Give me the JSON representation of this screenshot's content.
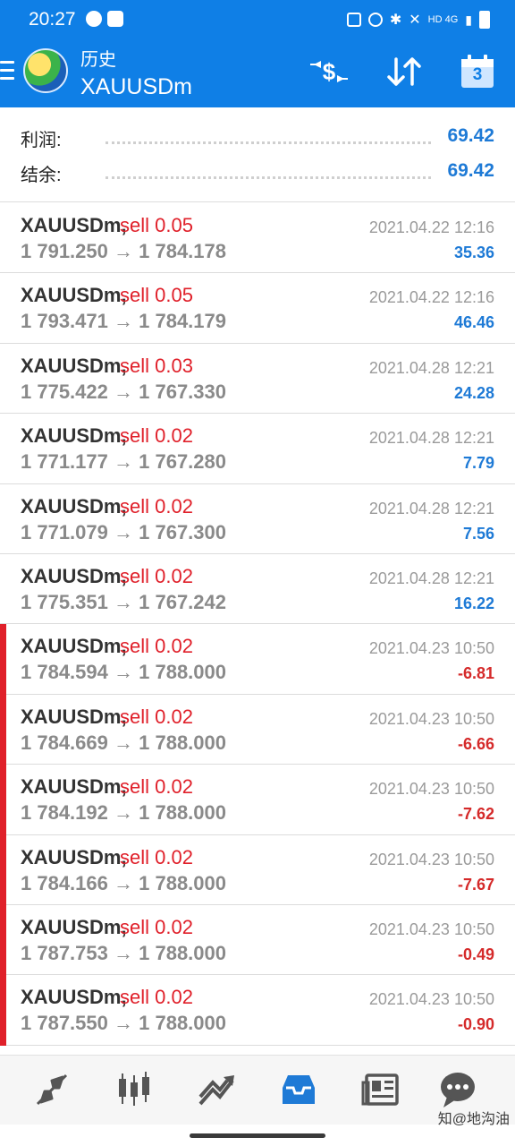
{
  "status_bar": {
    "time": "20:27",
    "network": "HD 4G"
  },
  "app_bar": {
    "subtitle": "历史",
    "title": "XAUUSDm",
    "calendar_day": "3"
  },
  "summary": {
    "profit_label": "利润:",
    "profit_value": "69.42",
    "balance_label": "结余:",
    "balance_value": "69.42"
  },
  "arrow": "→",
  "trades": [
    {
      "symbol": "XAUUSDm,",
      "side": "sell 0.05",
      "open": "1 791.250",
      "close": "1 784.178",
      "date": "2021.04.22 12:16",
      "profit": "35.36"
    },
    {
      "symbol": "XAUUSDm,",
      "side": "sell 0.05",
      "open": "1 793.471",
      "close": "1 784.179",
      "date": "2021.04.22 12:16",
      "profit": "46.46"
    },
    {
      "symbol": "XAUUSDm,",
      "side": "sell 0.03",
      "open": "1 775.422",
      "close": "1 767.330",
      "date": "2021.04.28 12:21",
      "profit": "24.28"
    },
    {
      "symbol": "XAUUSDm,",
      "side": "sell 0.02",
      "open": "1 771.177",
      "close": "1 767.280",
      "date": "2021.04.28 12:21",
      "profit": "7.79"
    },
    {
      "symbol": "XAUUSDm,",
      "side": "sell 0.02",
      "open": "1 771.079",
      "close": "1 767.300",
      "date": "2021.04.28 12:21",
      "profit": "7.56"
    },
    {
      "symbol": "XAUUSDm,",
      "side": "sell 0.02",
      "open": "1 775.351",
      "close": "1 767.242",
      "date": "2021.04.28 12:21",
      "profit": "16.22"
    },
    {
      "symbol": "XAUUSDm,",
      "side": "sell 0.02",
      "open": "1 784.594",
      "close": "1 788.000",
      "date": "2021.04.23 10:50",
      "profit": "-6.81"
    },
    {
      "symbol": "XAUUSDm,",
      "side": "sell 0.02",
      "open": "1 784.669",
      "close": "1 788.000",
      "date": "2021.04.23 10:50",
      "profit": "-6.66"
    },
    {
      "symbol": "XAUUSDm,",
      "side": "sell 0.02",
      "open": "1 784.192",
      "close": "1 788.000",
      "date": "2021.04.23 10:50",
      "profit": "-7.62"
    },
    {
      "symbol": "XAUUSDm,",
      "side": "sell 0.02",
      "open": "1 784.166",
      "close": "1 788.000",
      "date": "2021.04.23 10:50",
      "profit": "-7.67"
    },
    {
      "symbol": "XAUUSDm,",
      "side": "sell 0.02",
      "open": "1 787.753",
      "close": "1 788.000",
      "date": "2021.04.23 10:50",
      "profit": "-0.49"
    },
    {
      "symbol": "XAUUSDm,",
      "side": "sell 0.02",
      "open": "1 787.550",
      "close": "1 788.000",
      "date": "2021.04.23 10:50",
      "profit": "-0.90"
    }
  ],
  "bottom_nav": {
    "items": [
      {
        "icon": "quotes-arrows-icon",
        "active": false
      },
      {
        "icon": "candlestick-chart-icon",
        "active": false
      },
      {
        "icon": "trade-chart-icon",
        "active": false
      },
      {
        "icon": "history-inbox-icon",
        "active": true
      },
      {
        "icon": "news-icon",
        "active": false
      },
      {
        "icon": "chat-bubble-icon",
        "active": false
      }
    ]
  },
  "watermark": "知@地沟油",
  "colors": {
    "brand_blue": "#0f7fe6",
    "profit_blue": "#1e7ad6",
    "loss_red": "#d52a2a",
    "sell_red": "#e0202a"
  }
}
